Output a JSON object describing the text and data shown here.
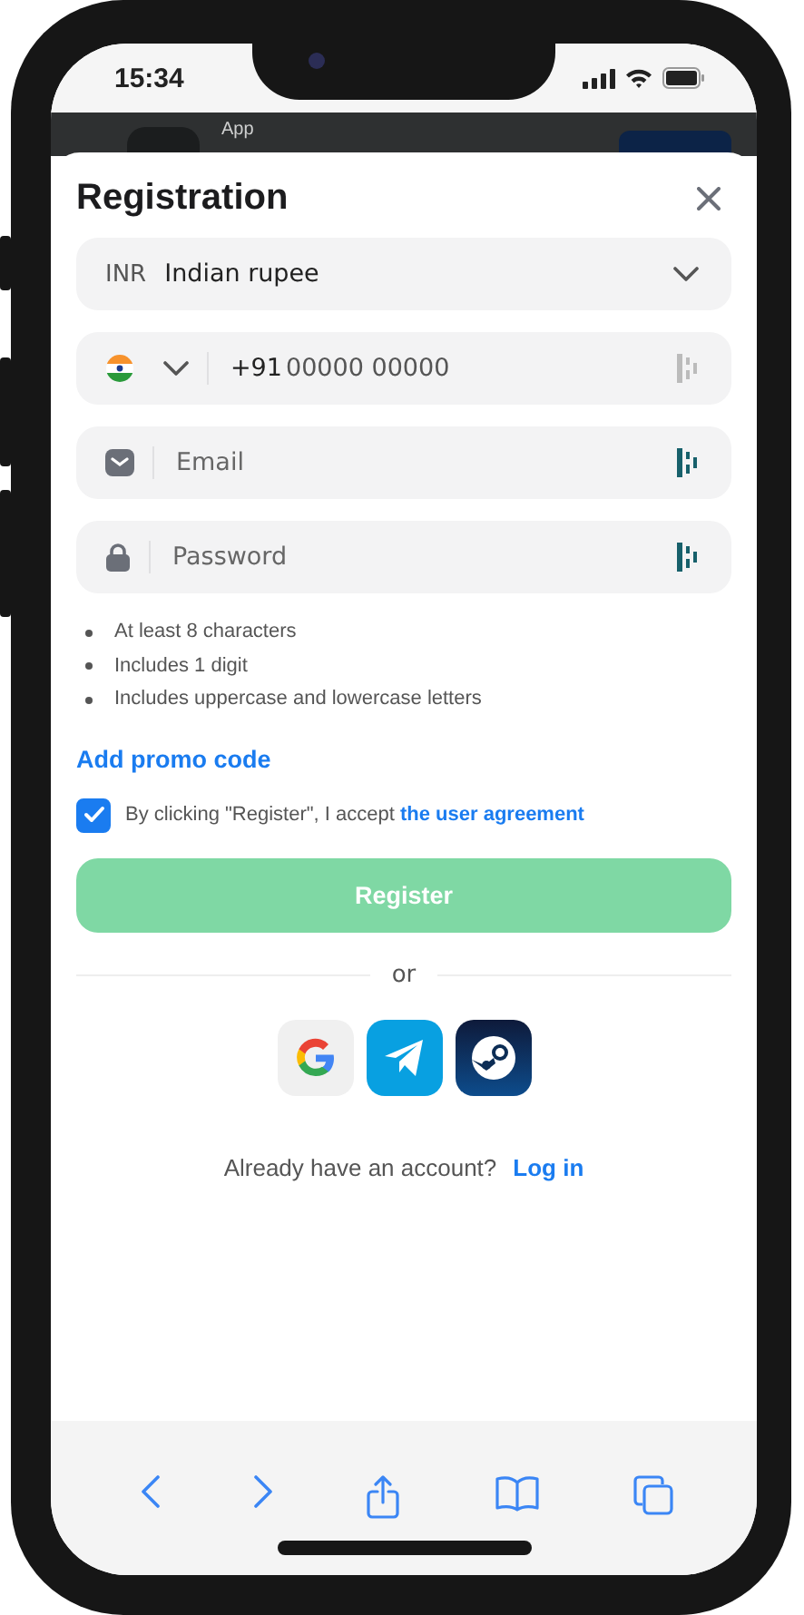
{
  "status_bar": {
    "time": "15:34"
  },
  "background_app": {
    "title": "App"
  },
  "modal": {
    "title": "Registration"
  },
  "currency": {
    "code": "INR",
    "name": "Indian rupee"
  },
  "phone": {
    "prefix": "+91",
    "placeholder": "00000 00000"
  },
  "email": {
    "placeholder": "Email"
  },
  "password": {
    "placeholder": "Password"
  },
  "password_rules": [
    "At least 8 characters",
    "Includes 1 digit",
    "Includes uppercase and lowercase letters"
  ],
  "promo_link": "Add promo code",
  "agreement": {
    "checked": true,
    "text": "By clicking \"Register\", I accept",
    "link": "the user agreement"
  },
  "register_button": {
    "label": "Register",
    "disabled": true
  },
  "divider": "or",
  "social": [
    {
      "kind": "google"
    },
    {
      "kind": "telegram"
    },
    {
      "kind": "steam"
    }
  ],
  "login": {
    "text": "Already have an account?",
    "link": "Log in"
  }
}
